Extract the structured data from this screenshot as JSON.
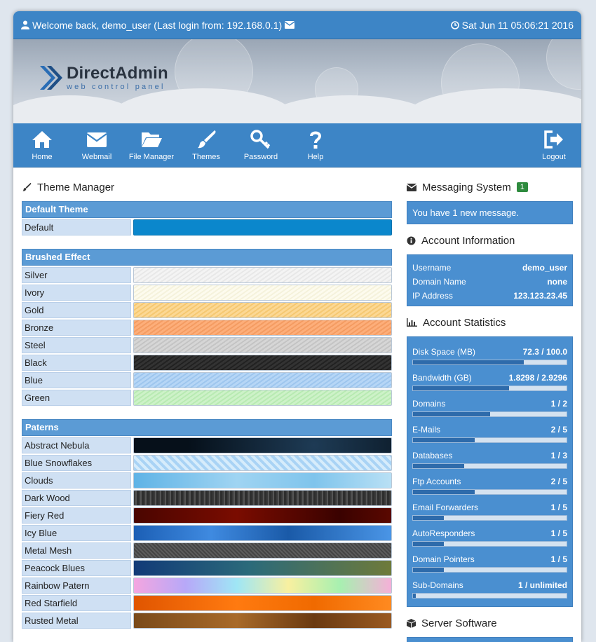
{
  "topbar": {
    "welcome": "Welcome back, demo_user (Last login from: 192.168.0.1)",
    "datetime": "Sat Jun 11 05:06:21 2016"
  },
  "logo": {
    "name": "DirectAdmin",
    "sub": "web control panel"
  },
  "nav": {
    "items": [
      {
        "label": "Home",
        "icon": "home-icon"
      },
      {
        "label": "Webmail",
        "icon": "envelope-icon"
      },
      {
        "label": "File Manager",
        "icon": "folder-open-icon"
      },
      {
        "label": "Themes",
        "icon": "brush-icon"
      },
      {
        "label": "Password",
        "icon": "key-icon"
      },
      {
        "label": "Help",
        "icon": "question-icon"
      }
    ],
    "logout": "Logout"
  },
  "theme_manager": {
    "title": "Theme Manager",
    "groups": [
      {
        "title": "Default Theme",
        "themes": [
          "Default"
        ]
      },
      {
        "title": "Brushed Effect",
        "themes": [
          "Silver",
          "Ivory",
          "Gold",
          "Bronze",
          "Steel",
          "Black",
          "Blue",
          "Green"
        ]
      },
      {
        "title": "Paterns",
        "themes": [
          "Abstract Nebula",
          "Blue Snowflakes",
          "Clouds",
          "Dark Wood",
          "Fiery Red",
          "Icy Blue",
          "Metal Mesh",
          "Peacock Blues",
          "Rainbow Patern",
          "Red Starfield",
          "Rusted Metal"
        ]
      }
    ]
  },
  "messaging": {
    "title": "Messaging System",
    "count": "1",
    "text": "You have 1 new message."
  },
  "account_info": {
    "title": "Account Information",
    "rows": [
      {
        "label": "Username",
        "value": "demo_user"
      },
      {
        "label": "Domain Name",
        "value": "none"
      },
      {
        "label": "IP Address",
        "value": "123.123.23.45"
      }
    ]
  },
  "account_stats": {
    "title": "Account Statistics",
    "stats": [
      {
        "label": "Disk Space (MB)",
        "value": "72.3 / 100.0",
        "fraction": 0.723
      },
      {
        "label": "Bandwidth (GB)",
        "value": "1.8298 / 2.9296",
        "fraction": 0.625
      },
      {
        "label": "Domains",
        "value": "1 / 2",
        "fraction": 0.5
      },
      {
        "label": "E-Mails",
        "value": "2 / 5",
        "fraction": 0.4
      },
      {
        "label": "Databases",
        "value": "1 / 3",
        "fraction": 0.333
      },
      {
        "label": "Ftp Accounts",
        "value": "2 / 5",
        "fraction": 0.4
      },
      {
        "label": "Email Forwarders",
        "value": "1 / 5",
        "fraction": 0.2
      },
      {
        "label": "AutoResponders",
        "value": "1 / 5",
        "fraction": 0.2
      },
      {
        "label": "Domain Pointers",
        "value": "1 / 5",
        "fraction": 0.2
      },
      {
        "label": "Sub-Domains",
        "value": "1 / unlimited",
        "fraction": 0.02
      }
    ]
  },
  "server_software": {
    "title": "Server Software"
  },
  "colors": {
    "accent": "#3d85c6",
    "row": "#cfe0f3",
    "bar_fill": "#2e6bab"
  }
}
